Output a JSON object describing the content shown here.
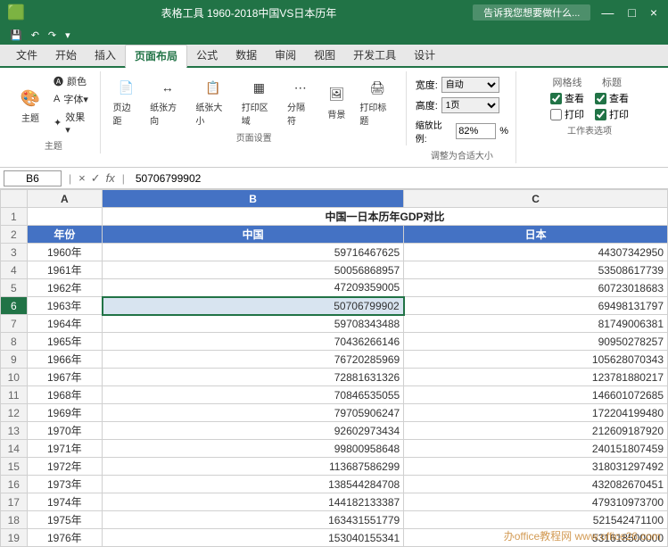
{
  "titleBar": {
    "title": "表格工具  1960-2018中国VS日本历年",
    "searchPlaceholder": "告诉我您想要做什么...",
    "windowControls": [
      "—",
      "□",
      "×"
    ]
  },
  "quickToolbar": {
    "buttons": [
      "保存",
      "撤销",
      "重做",
      "自定义"
    ]
  },
  "ribbonTabs": [
    "文件",
    "开始",
    "插入",
    "页面布局",
    "公式",
    "数据",
    "审阅",
    "视图",
    "开发工具",
    "设计"
  ],
  "activeTab": "页面布局",
  "ribbonGroups": {
    "theme": {
      "label": "主题",
      "buttons": [
        "颜色",
        "字体",
        "效果"
      ]
    },
    "pageSetup": {
      "label": "页面设置",
      "buttons": [
        "页边距",
        "纸张方向",
        "纸张大小",
        "打印区域",
        "分隔符",
        "背景",
        "打印标题"
      ]
    },
    "fitToPage": {
      "label": "调整为合适大小",
      "width": {
        "label": "宽度:",
        "value": "自动"
      },
      "height": {
        "label": "高度:",
        "value": "1页"
      },
      "scale": {
        "label": "缩放比例:",
        "value": "82%"
      }
    },
    "sheetOptions": {
      "label": "工作表选项",
      "gridlines": {
        "label": "网格线",
        "view": "查看",
        "print": "打印"
      },
      "headings": {
        "label": "标题",
        "view": "查看",
        "print": "打印"
      }
    }
  },
  "formulaBar": {
    "cellRef": "B6",
    "formula": "50706799902",
    "icons": [
      "×",
      "✓",
      "fx"
    ]
  },
  "columnHeaders": [
    "",
    "A",
    "B",
    "C"
  ],
  "spreadsheet": {
    "rows": [
      {
        "num": "1",
        "a": "",
        "b": "中国一日本历年GDP对比",
        "c": "",
        "type": "title"
      },
      {
        "num": "2",
        "a": "年份",
        "b": "中国",
        "c": "日本",
        "type": "header"
      },
      {
        "num": "3",
        "a": "1960年",
        "b": "59716467625",
        "c": "44307342950",
        "type": "data"
      },
      {
        "num": "4",
        "a": "1961年",
        "b": "50056868957",
        "c": "53508617739",
        "type": "data"
      },
      {
        "num": "5",
        "a": "1962年",
        "b": "47209359005",
        "c": "60723018683",
        "type": "data"
      },
      {
        "num": "6",
        "a": "1963年",
        "b": "50706799902",
        "c": "69498131797",
        "type": "data",
        "selected": true
      },
      {
        "num": "7",
        "a": "1964年",
        "b": "59708343488",
        "c": "81749006381",
        "type": "data"
      },
      {
        "num": "8",
        "a": "1965年",
        "b": "70436266146",
        "c": "90950278257",
        "type": "data"
      },
      {
        "num": "9",
        "a": "1966年",
        "b": "76720285969",
        "c": "105628070343",
        "type": "data"
      },
      {
        "num": "10",
        "a": "1967年",
        "b": "72881631326",
        "c": "123781880217",
        "type": "data"
      },
      {
        "num": "11",
        "a": "1968年",
        "b": "70846535055",
        "c": "146601072685",
        "type": "data"
      },
      {
        "num": "12",
        "a": "1969年",
        "b": "79705906247",
        "c": "172204199480",
        "type": "data"
      },
      {
        "num": "13",
        "a": "1970年",
        "b": "92602973434",
        "c": "212609187920",
        "type": "data"
      },
      {
        "num": "14",
        "a": "1971年",
        "b": "99800958648",
        "c": "240151807459",
        "type": "data"
      },
      {
        "num": "15",
        "a": "1972年",
        "b": "113687586299",
        "c": "318031297492",
        "type": "data"
      },
      {
        "num": "16",
        "a": "1973年",
        "b": "138544284708",
        "c": "432082670451",
        "type": "data"
      },
      {
        "num": "17",
        "a": "1974年",
        "b": "144182133387",
        "c": "4793...",
        "type": "data"
      },
      {
        "num": "18",
        "a": "1975年",
        "b": "163431551779",
        "c": "521...",
        "type": "data"
      },
      {
        "num": "19",
        "a": "1976年",
        "b": "153040155341",
        "c": "531618...",
        "type": "data"
      }
    ]
  },
  "watermark": "办office教程网 www.office26.com"
}
